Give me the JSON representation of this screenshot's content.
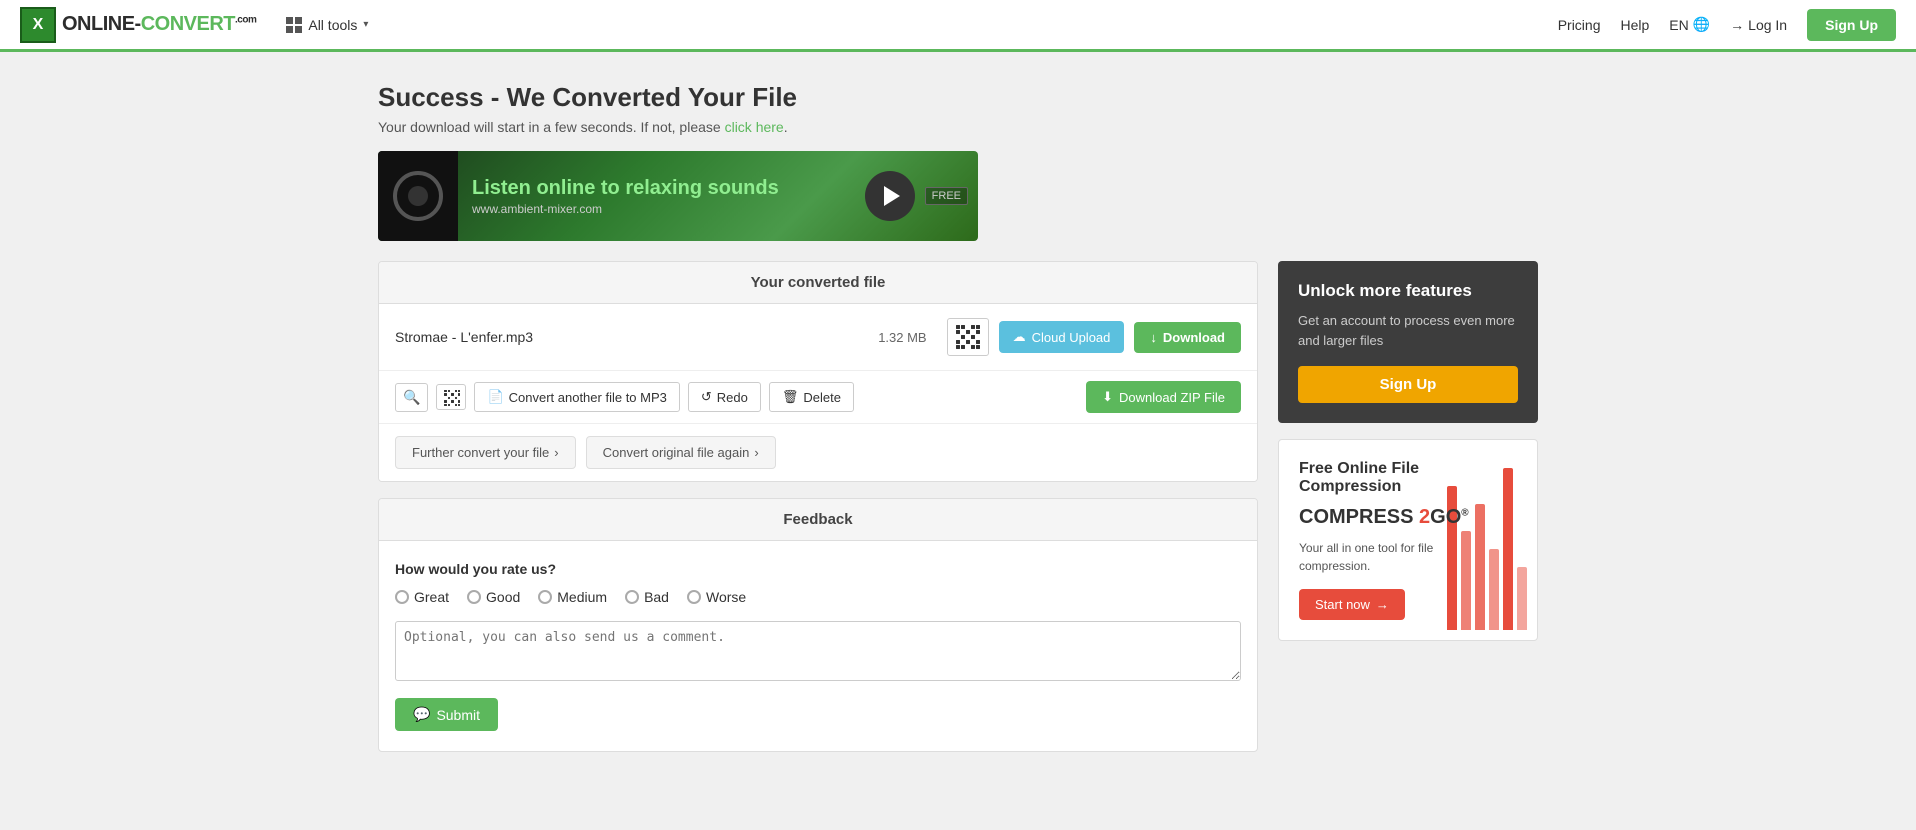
{
  "header": {
    "logo_text": "ONLINE-C",
    "logo_highlight": "ONVERT",
    "logo_suffix": ".com",
    "all_tools_label": "All tools",
    "nav": {
      "pricing": "Pricing",
      "help": "Help",
      "lang": "EN",
      "login": "Log In",
      "signup": "Sign Up"
    }
  },
  "page": {
    "title": "Success - We Converted Your File",
    "subtitle": "Your download will start in a few seconds. If not, please",
    "click_here": "click here",
    "click_here_suffix": "."
  },
  "ad_banner": {
    "text1": "Listen online to ",
    "text_highlight": "relaxing",
    "text2": " sounds",
    "url": "www.ambient-mixer.com",
    "cta": "PLAY NOW",
    "badge": "FREE"
  },
  "converted_file": {
    "panel_title": "Your converted file",
    "file_name": "Stromae - L'enfer.mp3",
    "file_size": "1.32 MB",
    "cloud_upload_label": "Cloud Upload",
    "download_label": "Download",
    "convert_another_label": "Convert another file to MP3",
    "redo_label": "Redo",
    "delete_label": "Delete",
    "download_zip_label": "Download ZIP File"
  },
  "further_convert": {
    "further_label": "Further convert your file",
    "further_icon": "›",
    "convert_again_label": "Convert original file again",
    "convert_again_icon": "›"
  },
  "feedback": {
    "panel_title": "Feedback",
    "question": "How would you rate us?",
    "options": [
      {
        "label": "Great",
        "value": "great"
      },
      {
        "label": "Good",
        "value": "good"
      },
      {
        "label": "Medium",
        "value": "medium"
      },
      {
        "label": "Bad",
        "value": "bad"
      },
      {
        "label": "Worse",
        "value": "worse"
      }
    ],
    "comment_placeholder": "Optional, you can also send us a comment.",
    "submit_label": "Submit"
  },
  "unlock_panel": {
    "title": "Unlock more features",
    "description": "Get an account to process even more and larger files",
    "signup_label": "Sign Up"
  },
  "compress_ad": {
    "title": "Free Online File Compression",
    "logo_text": "COMPRESS",
    "logo_num": "2",
    "logo_suffix": "GO",
    "description": "Your all in one tool for file compression.",
    "cta_label": "Start now",
    "bars": [
      80,
      55,
      70,
      45,
      90,
      35
    ]
  }
}
